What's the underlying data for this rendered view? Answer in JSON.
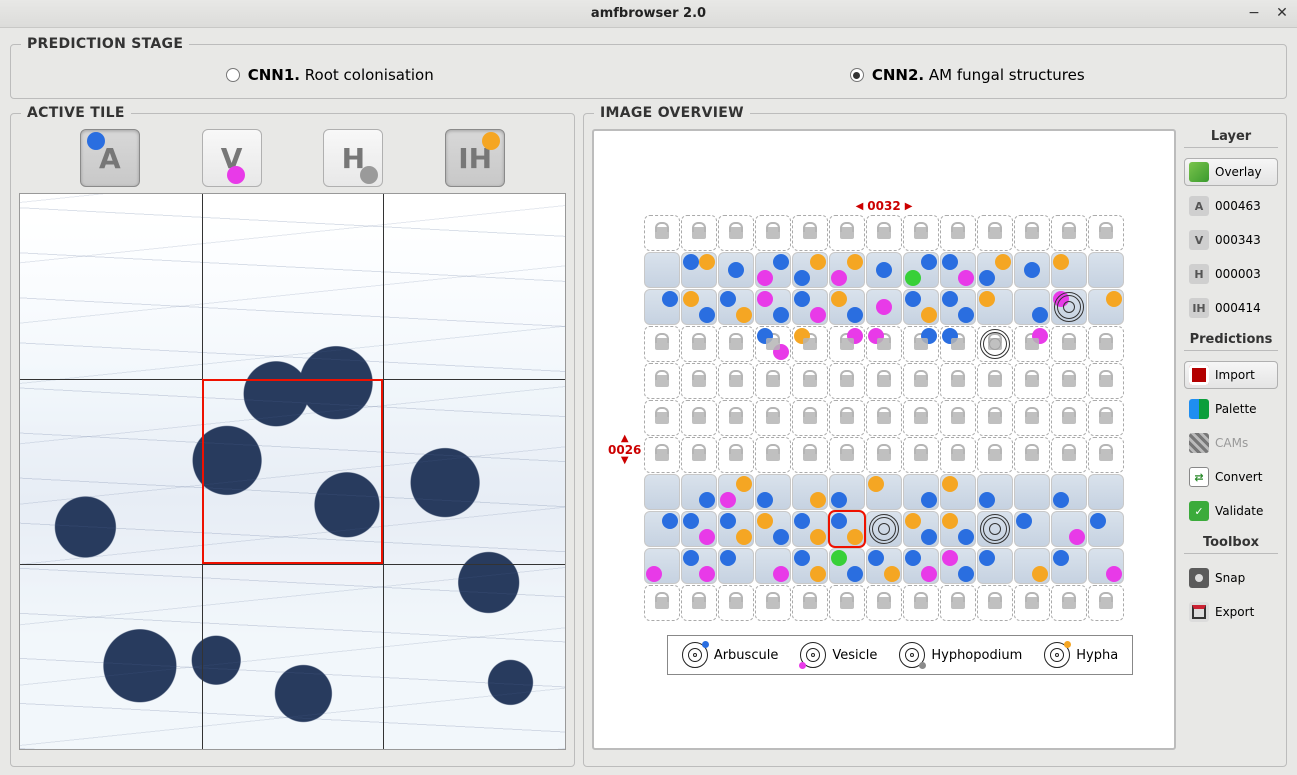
{
  "window": {
    "title": "amfbrowser 2.0"
  },
  "prediction_stage": {
    "legend": "PREDICTION STAGE",
    "options": [
      {
        "key": "cnn1",
        "bold": "CNN1.",
        "text": " Root colonisation",
        "checked": false
      },
      {
        "key": "cnn2",
        "bold": "CNN2.",
        "text": " AM fungal structures",
        "checked": true
      }
    ]
  },
  "active_tile": {
    "legend": "ACTIVE TILE",
    "buttons": [
      {
        "label": "A",
        "dot": "blue",
        "dotpos": "tl",
        "selected": true
      },
      {
        "label": "V",
        "dot": "mag",
        "dotpos": "bl",
        "selected": false
      },
      {
        "label": "H",
        "dot": "grey",
        "dotpos": "br",
        "selected": false
      },
      {
        "label": "IH",
        "dot": "orng",
        "dotpos": "tr",
        "selected": true
      }
    ]
  },
  "overview": {
    "legend": "IMAGE OVERVIEW",
    "x_coord": "0032",
    "y_coord": "0026",
    "selected": {
      "row": 8,
      "col": 5
    },
    "grid": {
      "rows": 11,
      "cols": 13,
      "root_rows": [
        1,
        2,
        7,
        8,
        9
      ],
      "dots": [
        {
          "r": 1,
          "c": 1,
          "cls": "b",
          "p": "tl"
        },
        {
          "r": 1,
          "c": 1,
          "cls": "o",
          "p": "tr"
        },
        {
          "r": 1,
          "c": 2,
          "cls": "b",
          "p": "c"
        },
        {
          "r": 1,
          "c": 3,
          "cls": "m",
          "p": "bl"
        },
        {
          "r": 1,
          "c": 3,
          "cls": "b",
          "p": "tr"
        },
        {
          "r": 1,
          "c": 4,
          "cls": "o",
          "p": "tr"
        },
        {
          "r": 1,
          "c": 4,
          "cls": "b",
          "p": "bl"
        },
        {
          "r": 1,
          "c": 5,
          "cls": "m",
          "p": "bl"
        },
        {
          "r": 1,
          "c": 5,
          "cls": "o",
          "p": "tr"
        },
        {
          "r": 1,
          "c": 6,
          "cls": "b",
          "p": "c"
        },
        {
          "r": 1,
          "c": 7,
          "cls": "b",
          "p": "tr"
        },
        {
          "r": 1,
          "c": 7,
          "cls": "g",
          "p": "bl"
        },
        {
          "r": 1,
          "c": 8,
          "cls": "b",
          "p": "tl"
        },
        {
          "r": 1,
          "c": 8,
          "cls": "m",
          "p": "br"
        },
        {
          "r": 1,
          "c": 9,
          "cls": "o",
          "p": "tr"
        },
        {
          "r": 1,
          "c": 9,
          "cls": "b",
          "p": "bl"
        },
        {
          "r": 1,
          "c": 10,
          "cls": "b",
          "p": "c"
        },
        {
          "r": 1,
          "c": 11,
          "cls": "o",
          "p": "tl"
        },
        {
          "r": 2,
          "c": 0,
          "cls": "b",
          "p": "tr"
        },
        {
          "r": 2,
          "c": 1,
          "cls": "o",
          "p": "tl"
        },
        {
          "r": 2,
          "c": 1,
          "cls": "b",
          "p": "br"
        },
        {
          "r": 2,
          "c": 2,
          "cls": "b",
          "p": "tl"
        },
        {
          "r": 2,
          "c": 2,
          "cls": "o",
          "p": "br"
        },
        {
          "r": 2,
          "c": 3,
          "cls": "m",
          "p": "tl"
        },
        {
          "r": 2,
          "c": 3,
          "cls": "b",
          "p": "br"
        },
        {
          "r": 2,
          "c": 4,
          "cls": "b",
          "p": "tl"
        },
        {
          "r": 2,
          "c": 4,
          "cls": "m",
          "p": "br"
        },
        {
          "r": 2,
          "c": 5,
          "cls": "o",
          "p": "tl"
        },
        {
          "r": 2,
          "c": 5,
          "cls": "b",
          "p": "br"
        },
        {
          "r": 2,
          "c": 6,
          "cls": "m",
          "p": "c"
        },
        {
          "r": 2,
          "c": 7,
          "cls": "b",
          "p": "tl"
        },
        {
          "r": 2,
          "c": 7,
          "cls": "o",
          "p": "br"
        },
        {
          "r": 2,
          "c": 8,
          "cls": "b",
          "p": "tl"
        },
        {
          "r": 2,
          "c": 8,
          "cls": "b",
          "p": "br"
        },
        {
          "r": 2,
          "c": 9,
          "cls": "o",
          "p": "tl"
        },
        {
          "r": 2,
          "c": 10,
          "cls": "b",
          "p": "br"
        },
        {
          "r": 2,
          "c": 11,
          "cls": "m",
          "p": "tl"
        },
        {
          "r": 2,
          "c": 12,
          "cls": "o",
          "p": "tr"
        },
        {
          "r": 3,
          "c": 3,
          "cls": "b",
          "p": "tl"
        },
        {
          "r": 3,
          "c": 3,
          "cls": "m",
          "p": "br"
        },
        {
          "r": 3,
          "c": 4,
          "cls": "o",
          "p": "tl"
        },
        {
          "r": 3,
          "c": 5,
          "cls": "m",
          "p": "tr"
        },
        {
          "r": 3,
          "c": 6,
          "cls": "m",
          "p": "tl"
        },
        {
          "r": 3,
          "c": 7,
          "cls": "b",
          "p": "tr"
        },
        {
          "r": 3,
          "c": 8,
          "cls": "b",
          "p": "tl"
        },
        {
          "r": 3,
          "c": 10,
          "cls": "m",
          "p": "tr"
        },
        {
          "r": 7,
          "c": 1,
          "cls": "b",
          "p": "br"
        },
        {
          "r": 7,
          "c": 2,
          "cls": "m",
          "p": "bl"
        },
        {
          "r": 7,
          "c": 2,
          "cls": "o",
          "p": "tr"
        },
        {
          "r": 7,
          "c": 3,
          "cls": "b",
          "p": "bl"
        },
        {
          "r": 7,
          "c": 4,
          "cls": "o",
          "p": "br"
        },
        {
          "r": 7,
          "c": 5,
          "cls": "b",
          "p": "bl"
        },
        {
          "r": 7,
          "c": 6,
          "cls": "o",
          "p": "tl"
        },
        {
          "r": 7,
          "c": 7,
          "cls": "b",
          "p": "br"
        },
        {
          "r": 7,
          "c": 8,
          "cls": "o",
          "p": "tl"
        },
        {
          "r": 7,
          "c": 9,
          "cls": "b",
          "p": "bl"
        },
        {
          "r": 7,
          "c": 11,
          "cls": "b",
          "p": "bl"
        },
        {
          "r": 8,
          "c": 0,
          "cls": "b",
          "p": "tr"
        },
        {
          "r": 8,
          "c": 1,
          "cls": "b",
          "p": "tl"
        },
        {
          "r": 8,
          "c": 1,
          "cls": "m",
          "p": "br"
        },
        {
          "r": 8,
          "c": 2,
          "cls": "b",
          "p": "tl"
        },
        {
          "r": 8,
          "c": 2,
          "cls": "o",
          "p": "br"
        },
        {
          "r": 8,
          "c": 3,
          "cls": "o",
          "p": "tl"
        },
        {
          "r": 8,
          "c": 3,
          "cls": "b",
          "p": "br"
        },
        {
          "r": 8,
          "c": 4,
          "cls": "b",
          "p": "tl"
        },
        {
          "r": 8,
          "c": 4,
          "cls": "o",
          "p": "br"
        },
        {
          "r": 8,
          "c": 5,
          "cls": "b",
          "p": "tl"
        },
        {
          "r": 8,
          "c": 5,
          "cls": "o",
          "p": "br"
        },
        {
          "r": 8,
          "c": 7,
          "cls": "o",
          "p": "tl"
        },
        {
          "r": 8,
          "c": 7,
          "cls": "b",
          "p": "br"
        },
        {
          "r": 8,
          "c": 8,
          "cls": "o",
          "p": "tl"
        },
        {
          "r": 8,
          "c": 8,
          "cls": "b",
          "p": "br"
        },
        {
          "r": 8,
          "c": 10,
          "cls": "b",
          "p": "tl"
        },
        {
          "r": 8,
          "c": 11,
          "cls": "m",
          "p": "br"
        },
        {
          "r": 8,
          "c": 12,
          "cls": "b",
          "p": "tl"
        },
        {
          "r": 9,
          "c": 0,
          "cls": "m",
          "p": "bl"
        },
        {
          "r": 9,
          "c": 1,
          "cls": "b",
          "p": "tl"
        },
        {
          "r": 9,
          "c": 1,
          "cls": "m",
          "p": "br"
        },
        {
          "r": 9,
          "c": 2,
          "cls": "b",
          "p": "tl"
        },
        {
          "r": 9,
          "c": 3,
          "cls": "m",
          "p": "br"
        },
        {
          "r": 9,
          "c": 4,
          "cls": "b",
          "p": "tl"
        },
        {
          "r": 9,
          "c": 4,
          "cls": "o",
          "p": "br"
        },
        {
          "r": 9,
          "c": 5,
          "cls": "g",
          "p": "tl"
        },
        {
          "r": 9,
          "c": 5,
          "cls": "b",
          "p": "br"
        },
        {
          "r": 9,
          "c": 6,
          "cls": "b",
          "p": "tl"
        },
        {
          "r": 9,
          "c": 6,
          "cls": "o",
          "p": "br"
        },
        {
          "r": 9,
          "c": 7,
          "cls": "b",
          "p": "tl"
        },
        {
          "r": 9,
          "c": 7,
          "cls": "m",
          "p": "br"
        },
        {
          "r": 9,
          "c": 8,
          "cls": "m",
          "p": "tl"
        },
        {
          "r": 9,
          "c": 8,
          "cls": "b",
          "p": "br"
        },
        {
          "r": 9,
          "c": 9,
          "cls": "b",
          "p": "tl"
        },
        {
          "r": 9,
          "c": 10,
          "cls": "o",
          "p": "br"
        },
        {
          "r": 9,
          "c": 11,
          "cls": "b",
          "p": "tl"
        },
        {
          "r": 9,
          "c": 12,
          "cls": "m",
          "p": "br"
        }
      ],
      "rings": [
        {
          "r": 2,
          "c": 11
        },
        {
          "r": 3,
          "c": 9
        },
        {
          "r": 8,
          "c": 6
        },
        {
          "r": 8,
          "c": 9
        }
      ]
    },
    "legend_items": [
      {
        "name": "Arbuscule",
        "dot": "b"
      },
      {
        "name": "Vesicle",
        "dot": "m"
      },
      {
        "name": "Hyphopodium",
        "dot": "gy"
      },
      {
        "name": "Hypha",
        "dot": "o"
      }
    ]
  },
  "sidebar": {
    "sections": [
      {
        "title": "Layer",
        "items": [
          {
            "icon": "layers",
            "label": "Overlay",
            "framed": true
          },
          {
            "icon": "letter",
            "letter": "A",
            "label": "000463"
          },
          {
            "icon": "letter",
            "letter": "V",
            "label": "000343"
          },
          {
            "icon": "letter",
            "letter": "H",
            "label": "000003"
          },
          {
            "icon": "letter",
            "letter": "IH",
            "label": "000414"
          }
        ]
      },
      {
        "title": "Predictions",
        "items": [
          {
            "icon": "import",
            "label": "Import",
            "framed": true
          },
          {
            "icon": "palette",
            "label": "Palette"
          },
          {
            "icon": "cams",
            "label": "CAMs",
            "disabled": true
          },
          {
            "icon": "convert",
            "label": "Convert"
          },
          {
            "icon": "validate",
            "label": "Validate"
          }
        ]
      },
      {
        "title": "Toolbox",
        "items": [
          {
            "icon": "snap",
            "label": "Snap"
          },
          {
            "icon": "export",
            "label": "Export"
          }
        ]
      }
    ]
  }
}
